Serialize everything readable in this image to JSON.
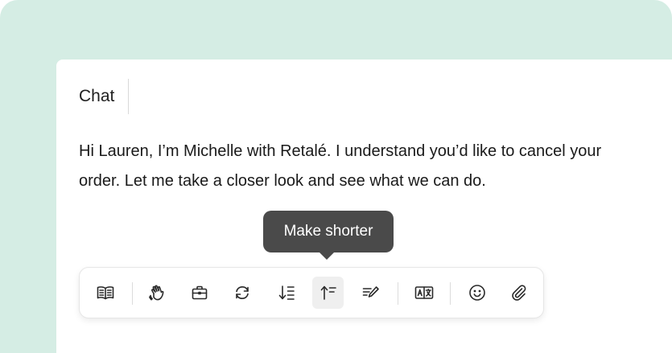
{
  "panel": {
    "tab_label": "Chat"
  },
  "message": {
    "text": "Hi Lauren, I’m Michelle with Retalé. I understand you’d like to cancel your order. Let me take a closer look and see what we can do."
  },
  "tooltip": {
    "text": "Make shorter"
  },
  "toolbar": {
    "active_item": "make-shorter",
    "items": [
      {
        "icon": "book-icon"
      },
      {
        "icon": "waving-hand-icon"
      },
      {
        "icon": "briefcase-icon"
      },
      {
        "icon": "refresh-icon"
      },
      {
        "icon": "make-longer-icon"
      },
      {
        "icon": "make-shorter-icon"
      },
      {
        "icon": "edit-text-icon"
      },
      {
        "icon": "translate-icon"
      },
      {
        "icon": "emoji-icon"
      },
      {
        "icon": "paperclip-icon"
      }
    ]
  },
  "colors": {
    "background": "#d5ede4",
    "card": "#ffffff",
    "tooltip": "#4a4a4a",
    "active_button": "#efefef"
  }
}
